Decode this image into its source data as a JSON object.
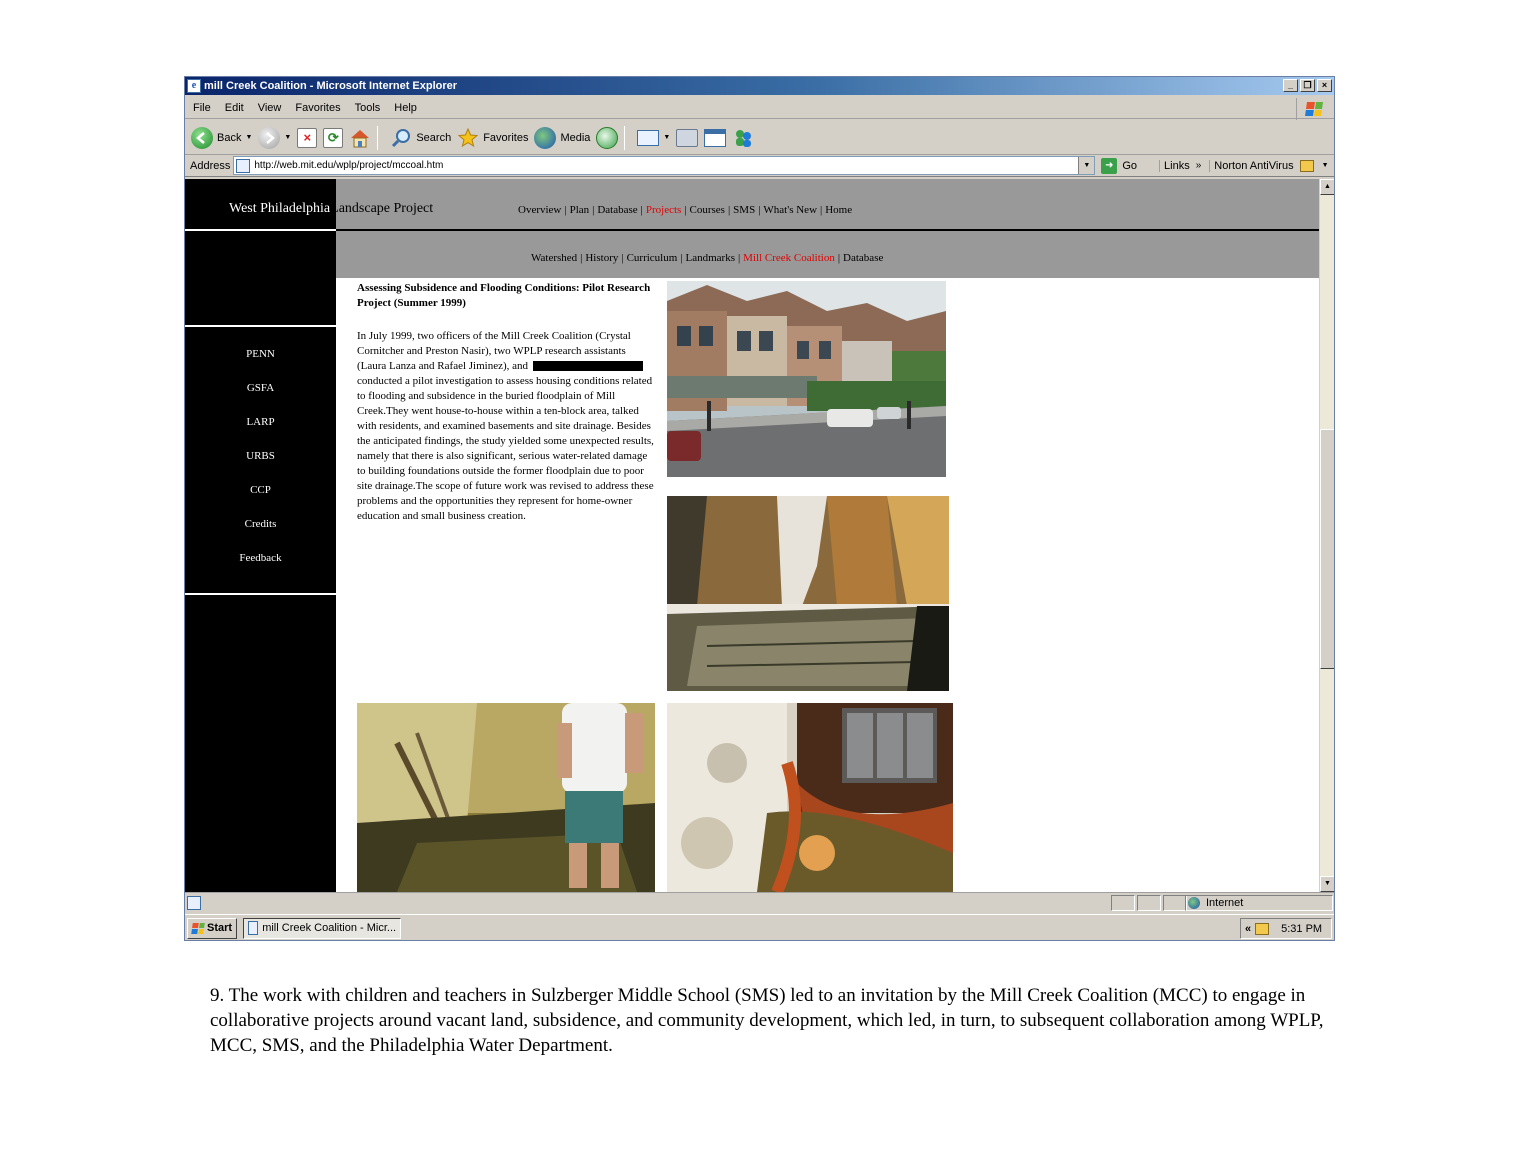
{
  "window": {
    "title": "mill Creek Coalition - Microsoft Internet Explorer",
    "buttons": {
      "minimize": "_",
      "restore": "❐",
      "close": "×"
    }
  },
  "menu": [
    "File",
    "Edit",
    "View",
    "Favorites",
    "Tools",
    "Help"
  ],
  "toolbar": {
    "back_label": "Back",
    "search_label": "Search",
    "favorites_label": "Favorites",
    "media_label": "Media"
  },
  "address": {
    "label": "Address",
    "url": "http://web.mit.edu/wplp/project/mccoal.htm",
    "go_label": "Go",
    "links_label": "Links",
    "chevron": "»",
    "norton_label": "Norton AntiVirus"
  },
  "page": {
    "site_title_part1": "West Philadelphia",
    "site_title_part2": "Landscape Project",
    "top_nav": [
      {
        "label": "Overview",
        "active": false
      },
      {
        "label": "Plan",
        "active": false
      },
      {
        "label": "Database",
        "active": false
      },
      {
        "label": "Projects",
        "active": true
      },
      {
        "label": "Courses",
        "active": false
      },
      {
        "label": "SMS",
        "active": false
      },
      {
        "label": "What's New",
        "active": false
      },
      {
        "label": "Home",
        "active": false
      }
    ],
    "sub_nav": [
      {
        "label": "Watershed",
        "active": false
      },
      {
        "label": "History",
        "active": false
      },
      {
        "label": "Curriculum",
        "active": false
      },
      {
        "label": "Landmarks",
        "active": false
      },
      {
        "label": "Mill Creek Coalition",
        "active": true
      },
      {
        "label": "Database",
        "active": false
      }
    ],
    "sidebar_links": [
      "PENN",
      "GSFA",
      "LARP",
      "URBS",
      "CCP",
      "Credits",
      "Feedback"
    ],
    "article_title": "Assessing Subsidence and Flooding Conditions: Pilot Research Project (Summer 1999)",
    "article_body_before": "In July 1999, two officers of the Mill Creek Coalition (Crystal Cornitcher and Preston Nasir), two WPLP research assistants (Laura Lanza and Rafael Jiminez), and",
    "article_body_after": "conducted a pilot investigation to assess housing conditions related to flooding and subsidence in the buried floodplain of Mill Creek.They went house-to-house within a ten-block area, talked with residents, and examined basements and site drainage. Besides the anticipated findings, the study yielded some unexpected results, namely that there is also significant, serious water-related damage to building foundations outside the former floodplain due to poor site drainage.The scope of future work was revised to address these problems and the opportunities they represent for home-owner education and small business creation."
  },
  "status": {
    "zone": "Internet"
  },
  "taskbar": {
    "start": "Start",
    "task": "mill Creek Coalition - Micr...",
    "tray_chevron": "«",
    "clock": "5:31 PM"
  },
  "caption": "9. The work with children and teachers in Sulzberger Middle School (SMS) led to an invitation by the Mill Creek Coalition (MCC) to engage in collaborative projects around vacant land, subsidence, and community development, which led, in turn, to subsequent collaboration among WPLP, MCC, SMS, and the Philadelphia Water Department."
}
